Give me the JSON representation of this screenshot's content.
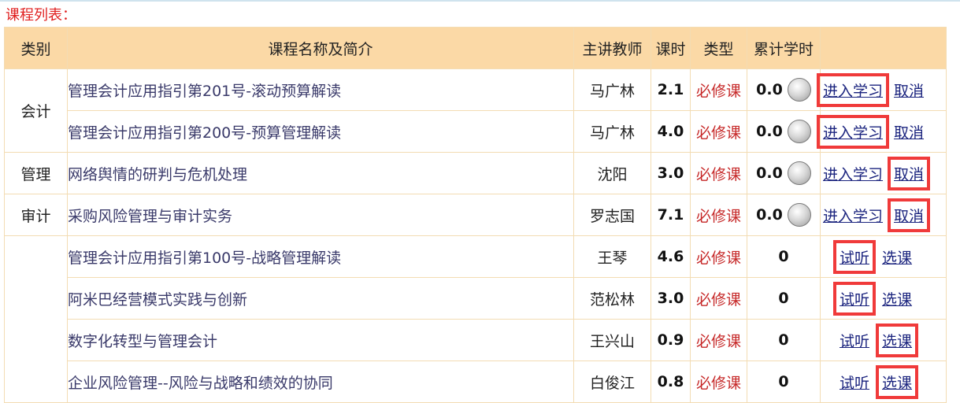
{
  "page": {
    "list_title": "课程列表："
  },
  "table": {
    "headers": [
      "类别",
      "课程名称及简介",
      "主讲教师",
      "课时",
      "类型",
      "累计学时",
      ""
    ],
    "groups": [
      {
        "category": "会计",
        "rows": [
          {
            "name": "管理会计应用指引第201号-滚动预算解读",
            "teacher": "马广林",
            "hours": "2.1",
            "type": "必修课",
            "accum": "0.0",
            "actions": [
              "进入学习",
              "取消"
            ]
          },
          {
            "name": "管理会计应用指引第200号-预算管理解读",
            "teacher": "马广林",
            "hours": "4.0",
            "type": "必修课",
            "accum": "0.0",
            "actions": [
              "进入学习",
              "取消"
            ]
          }
        ]
      },
      {
        "category": "管理",
        "rows": [
          {
            "name": "网络舆情的研判与危机处理",
            "teacher": "沈阳",
            "hours": "3.0",
            "type": "必修课",
            "accum": "0.0",
            "actions": [
              "进入学习",
              "取消"
            ]
          }
        ]
      },
      {
        "category": "审计",
        "rows": [
          {
            "name": "采购风险管理与审计实务",
            "teacher": "罗志国",
            "hours": "7.1",
            "type": "必修课",
            "accum": "0.0",
            "actions": [
              "进入学习",
              "取消"
            ]
          }
        ]
      },
      {
        "category": "",
        "rows": [
          {
            "name": "管理会计应用指引第100号-战略管理解读",
            "teacher": "王琴",
            "hours": "4.6",
            "type": "必修课",
            "accum": "0",
            "actions": [
              "试听",
              "选课"
            ]
          },
          {
            "name": "阿米巴经营模式实践与创新",
            "teacher": "范松林",
            "hours": "3.0",
            "type": "必修课",
            "accum": "0",
            "actions": [
              "试听",
              "选课"
            ]
          },
          {
            "name": "数字化转型与管理会计",
            "teacher": "王兴山",
            "hours": "0.9",
            "type": "必修课",
            "accum": "0",
            "actions": [
              "试听",
              "选课"
            ]
          },
          {
            "name": "企业风险管理--风险与战略和绩效的协同",
            "teacher": "白俊江",
            "hours": "0.8",
            "type": "必修课",
            "accum": "0",
            "actions": [
              "试听",
              "选课"
            ]
          }
        ]
      }
    ]
  }
}
